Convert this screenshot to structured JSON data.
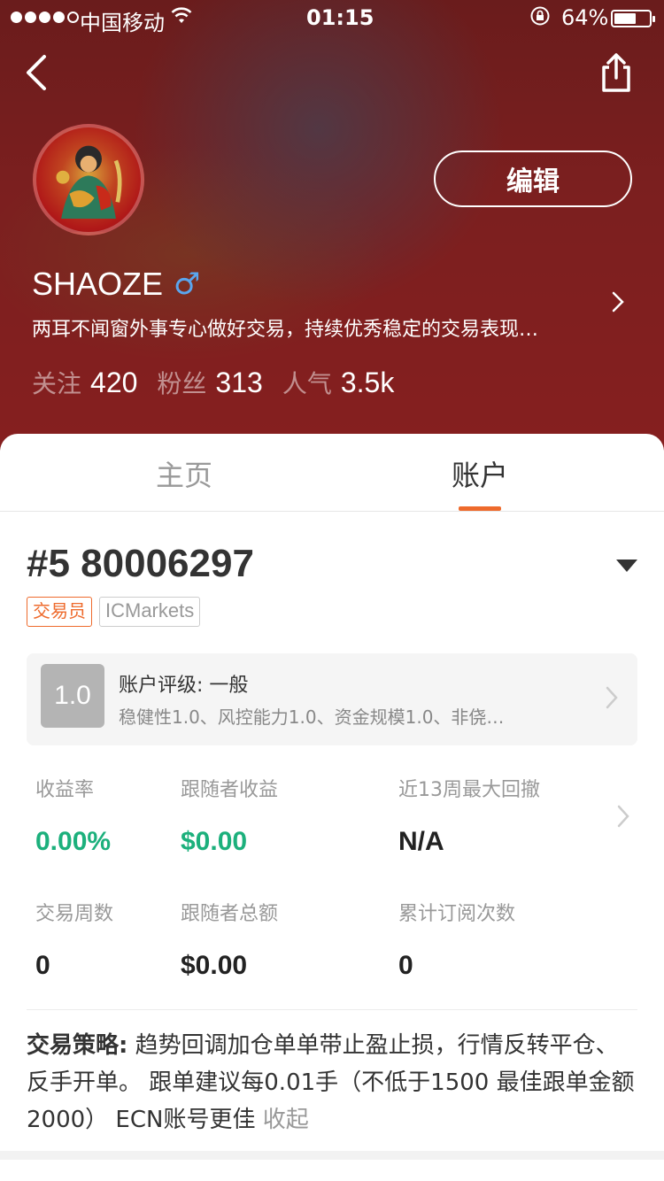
{
  "status_bar": {
    "carrier": "中国移动",
    "time": "01:15",
    "battery": "64%",
    "battery_level": 0.64
  },
  "header": {
    "edit_label": "编辑",
    "username": "SHAOZE",
    "gender_symbol": "♂",
    "bio": "两耳不闻窗外事专心做好交易，持续优秀稳定的交易表现…",
    "stats": [
      {
        "label": "关注",
        "value": "420"
      },
      {
        "label": "粉丝",
        "value": "313"
      },
      {
        "label": "人气",
        "value": "3.5k"
      }
    ]
  },
  "tabs": [
    {
      "label": "主页",
      "active": false
    },
    {
      "label": "账户",
      "active": true
    }
  ],
  "account": {
    "number": "#5 80006297",
    "badges": [
      "交易员",
      "ICMarkets"
    ],
    "rating_score": "1.0",
    "rating_title": "账户评级: 一般",
    "rating_desc": "稳健性1.0、风控能力1.0、资金规模1.0、非侥…"
  },
  "metrics": [
    {
      "label": "收益率",
      "value": "0.00%",
      "color": "#1cb07c"
    },
    {
      "label": "跟随者收益",
      "value": "$0.00",
      "color": "#1cb07c"
    },
    {
      "label": "近13周最大回撤",
      "value": "N/A",
      "color": "#222222"
    },
    {
      "label": "交易周数",
      "value": "0",
      "color": "#222222"
    },
    {
      "label": "跟随者总额",
      "value": "$0.00",
      "color": "#222222"
    },
    {
      "label": "累计订阅次数",
      "value": "0",
      "color": "#222222"
    }
  ],
  "strategy": {
    "label": "交易策略:",
    "text": " 趋势回调加仓单单带止盈止损，行情反转平仓、反手开单。 跟单建议每0.01手（不低于1500  最佳跟单金额2000）  ECN账号更佳 ",
    "collapse": "收起"
  },
  "colors": {
    "accent": "#ee6a2c",
    "positive": "#1cb07c",
    "hero": "#7b1f1f"
  }
}
